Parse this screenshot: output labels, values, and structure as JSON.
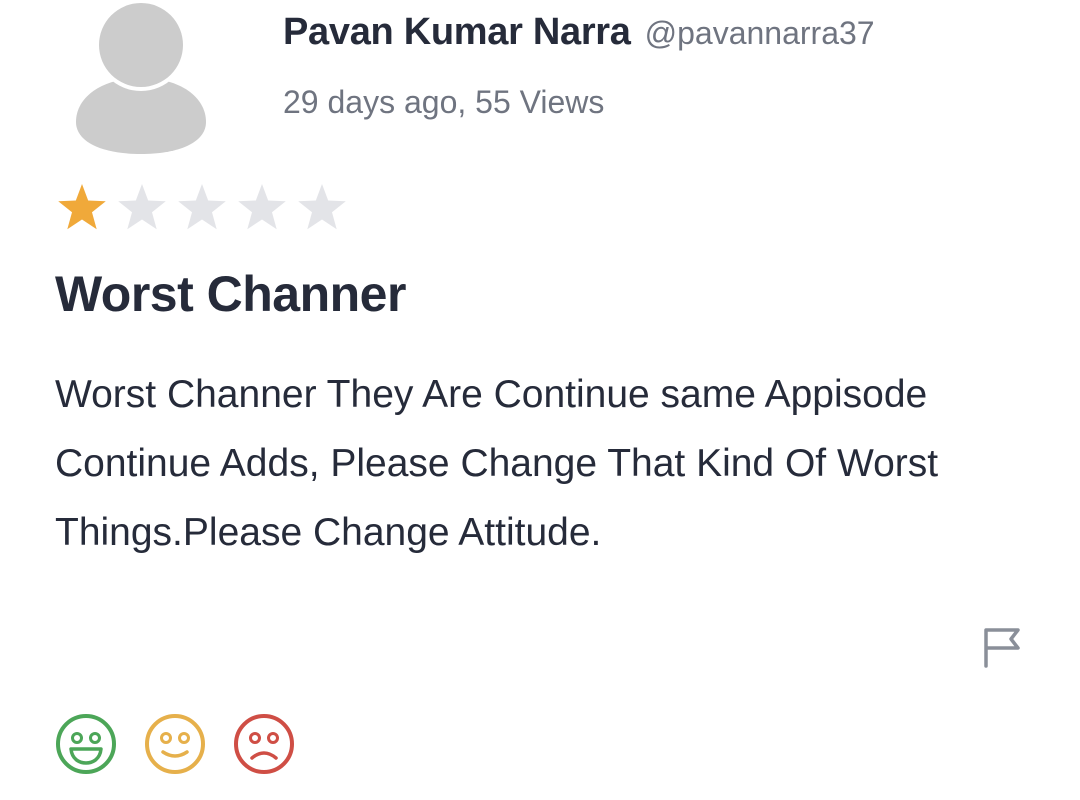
{
  "review": {
    "author_name": "Pavan Kumar Narra",
    "author_handle": "@pavannarra37",
    "meta": "29 days ago, 55 Views",
    "rating": 1,
    "rating_max": 5,
    "title": "Worst Channer",
    "body": "Worst Channer They Are Continue same Appisode Continue Adds, Please Change That Kind Of Worst Things.Please Change Attitude."
  },
  "icons": {
    "avatar": "default-user-avatar-icon",
    "star_filled": "star-filled-icon",
    "star_empty": "star-empty-icon",
    "flag": "flag-icon",
    "reaction_positive": "happy-face-icon",
    "reaction_neutral": "neutral-face-icon",
    "reaction_negative": "sad-face-icon"
  },
  "colors": {
    "star_filled": "#f0a93a",
    "star_empty": "#e3e4e8",
    "reaction_positive": "#4ca658",
    "reaction_neutral": "#e6b04b",
    "reaction_negative": "#cf4e45",
    "avatar": "#cccccc"
  }
}
